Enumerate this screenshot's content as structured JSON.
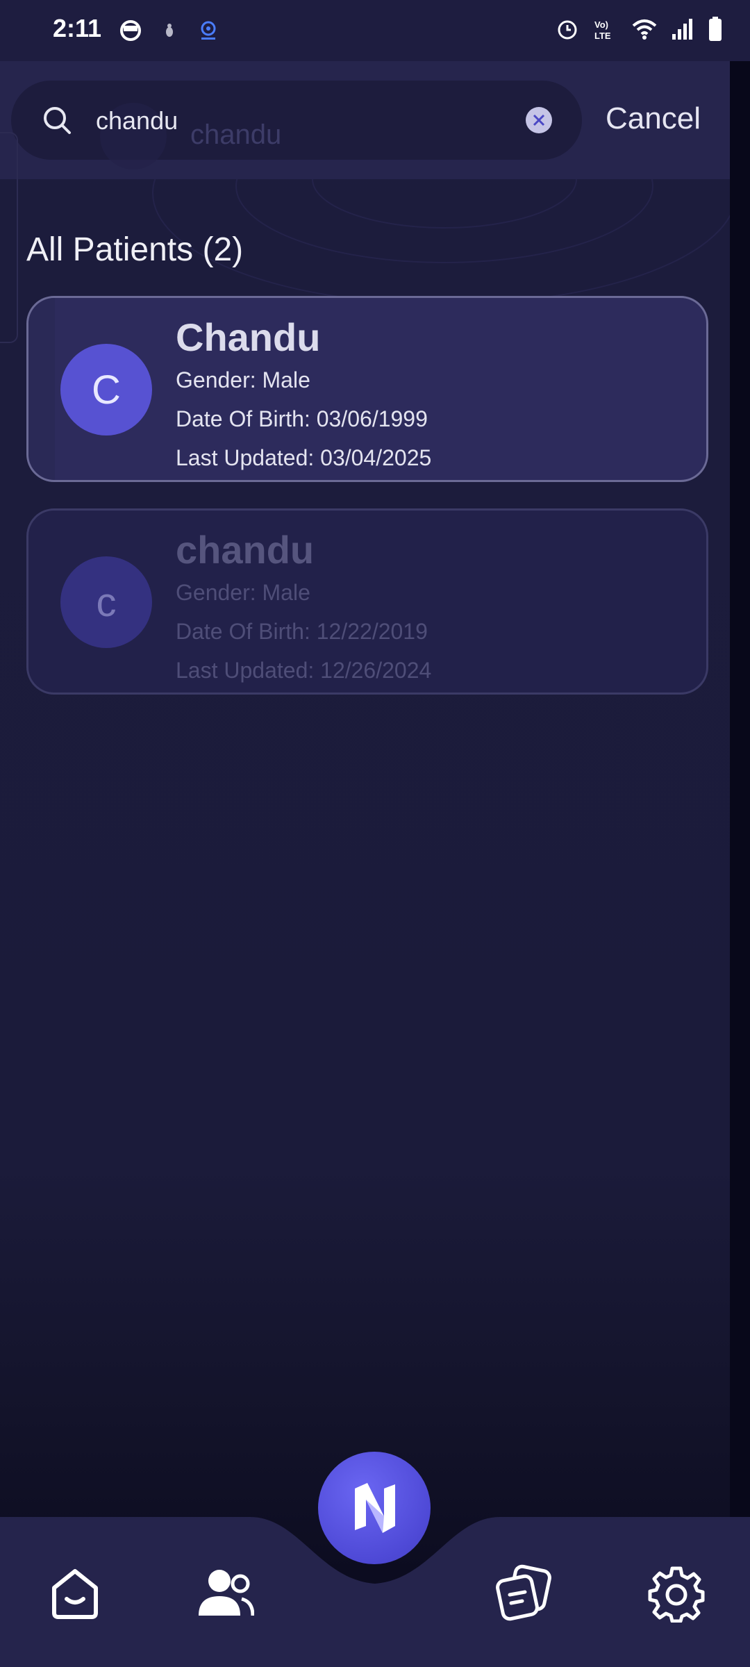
{
  "status_bar": {
    "time": "2:11",
    "left_icons": [
      "face-icon",
      "bug-icon",
      "webcam-icon"
    ],
    "right_icons": [
      "alarm-icon",
      "volte-icon",
      "wifi-icon",
      "signal-icon",
      "battery-icon"
    ]
  },
  "search": {
    "value": "chandu",
    "ghost_text": "chandu",
    "cancel_label": "Cancel"
  },
  "section": {
    "title": "All Patients (2)"
  },
  "patients": [
    {
      "initial": "C",
      "name": "Chandu",
      "gender": "Gender: Male",
      "dob": "Date Of Birth: 03/06/1999",
      "updated": "Last Updated: 03/04/2025"
    },
    {
      "initial": "c",
      "name": "chandu",
      "gender": "Gender: Male",
      "dob": "Date Of Birth: 12/22/2019",
      "updated": "Last Updated: 12/26/2024"
    }
  ],
  "bottom_nav": {
    "items": [
      "home-icon",
      "patients-icon",
      "n-logo-icon",
      "notes-icon",
      "settings-icon"
    ]
  },
  "colors": {
    "background": "#1c1c3d",
    "accent": "#5752d2",
    "nav": "#25244c"
  }
}
